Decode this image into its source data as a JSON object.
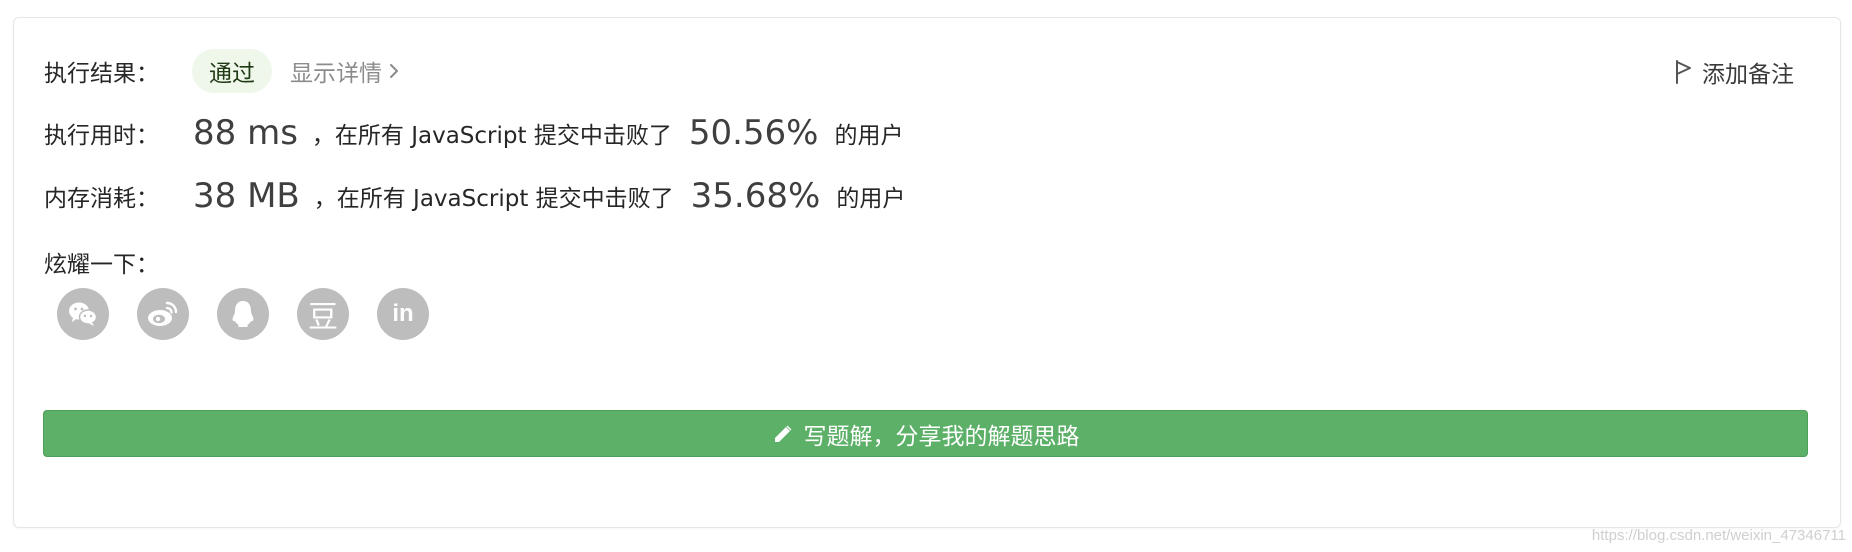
{
  "result": {
    "label": "执行结果：",
    "status": "通过",
    "details_link": "显示详情"
  },
  "add_note": "添加备注",
  "runtime": {
    "label": "执行用时：",
    "value": "88 ms",
    "middle": "，在所有 JavaScript 提交中击败了",
    "percent": "50.56%",
    "tail": "的用户"
  },
  "memory": {
    "label": "内存消耗：",
    "value": "38 MB",
    "middle": "，在所有 JavaScript 提交中击败了",
    "percent": "35.68%",
    "tail": "的用户"
  },
  "share": {
    "label": "炫耀一下：",
    "icons": [
      "wechat-icon",
      "weibo-icon",
      "qq-icon",
      "douban-icon",
      "linkedin-icon"
    ],
    "douban_glyph": "豆",
    "linkedin_glyph": "in"
  },
  "cta": {
    "label": "写题解，分享我的解题思路"
  },
  "watermark": "https://blog.csdn.net/weixin_47346711",
  "colors": {
    "accent_green": "#5cb067",
    "badge_bg": "#eef7ea",
    "icon_gray": "#bdbdbd"
  }
}
